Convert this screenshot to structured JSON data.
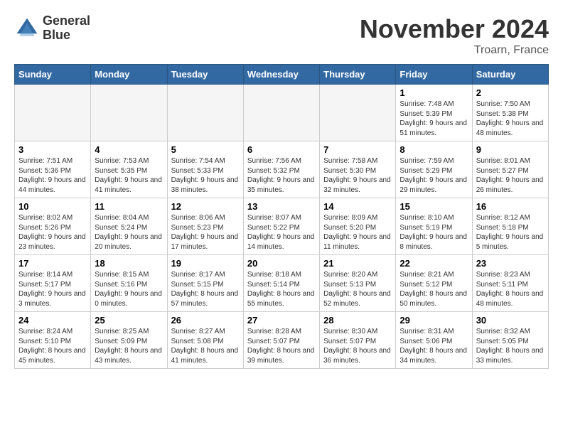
{
  "header": {
    "logo_line1": "General",
    "logo_line2": "Blue",
    "month": "November 2024",
    "location": "Troarn, France"
  },
  "weekdays": [
    "Sunday",
    "Monday",
    "Tuesday",
    "Wednesday",
    "Thursday",
    "Friday",
    "Saturday"
  ],
  "weeks": [
    [
      {
        "day": "",
        "empty": true
      },
      {
        "day": "",
        "empty": true
      },
      {
        "day": "",
        "empty": true
      },
      {
        "day": "",
        "empty": true
      },
      {
        "day": "",
        "empty": true
      },
      {
        "day": "1",
        "sunrise": "Sunrise: 7:48 AM",
        "sunset": "Sunset: 5:39 PM",
        "daylight": "Daylight: 9 hours and 51 minutes."
      },
      {
        "day": "2",
        "sunrise": "Sunrise: 7:50 AM",
        "sunset": "Sunset: 5:38 PM",
        "daylight": "Daylight: 9 hours and 48 minutes."
      }
    ],
    [
      {
        "day": "3",
        "sunrise": "Sunrise: 7:51 AM",
        "sunset": "Sunset: 5:36 PM",
        "daylight": "Daylight: 9 hours and 44 minutes."
      },
      {
        "day": "4",
        "sunrise": "Sunrise: 7:53 AM",
        "sunset": "Sunset: 5:35 PM",
        "daylight": "Daylight: 9 hours and 41 minutes."
      },
      {
        "day": "5",
        "sunrise": "Sunrise: 7:54 AM",
        "sunset": "Sunset: 5:33 PM",
        "daylight": "Daylight: 9 hours and 38 minutes."
      },
      {
        "day": "6",
        "sunrise": "Sunrise: 7:56 AM",
        "sunset": "Sunset: 5:32 PM",
        "daylight": "Daylight: 9 hours and 35 minutes."
      },
      {
        "day": "7",
        "sunrise": "Sunrise: 7:58 AM",
        "sunset": "Sunset: 5:30 PM",
        "daylight": "Daylight: 9 hours and 32 minutes."
      },
      {
        "day": "8",
        "sunrise": "Sunrise: 7:59 AM",
        "sunset": "Sunset: 5:29 PM",
        "daylight": "Daylight: 9 hours and 29 minutes."
      },
      {
        "day": "9",
        "sunrise": "Sunrise: 8:01 AM",
        "sunset": "Sunset: 5:27 PM",
        "daylight": "Daylight: 9 hours and 26 minutes."
      }
    ],
    [
      {
        "day": "10",
        "sunrise": "Sunrise: 8:02 AM",
        "sunset": "Sunset: 5:26 PM",
        "daylight": "Daylight: 9 hours and 23 minutes."
      },
      {
        "day": "11",
        "sunrise": "Sunrise: 8:04 AM",
        "sunset": "Sunset: 5:24 PM",
        "daylight": "Daylight: 9 hours and 20 minutes."
      },
      {
        "day": "12",
        "sunrise": "Sunrise: 8:06 AM",
        "sunset": "Sunset: 5:23 PM",
        "daylight": "Daylight: 9 hours and 17 minutes."
      },
      {
        "day": "13",
        "sunrise": "Sunrise: 8:07 AM",
        "sunset": "Sunset: 5:22 PM",
        "daylight": "Daylight: 9 hours and 14 minutes."
      },
      {
        "day": "14",
        "sunrise": "Sunrise: 8:09 AM",
        "sunset": "Sunset: 5:20 PM",
        "daylight": "Daylight: 9 hours and 11 minutes."
      },
      {
        "day": "15",
        "sunrise": "Sunrise: 8:10 AM",
        "sunset": "Sunset: 5:19 PM",
        "daylight": "Daylight: 9 hours and 8 minutes."
      },
      {
        "day": "16",
        "sunrise": "Sunrise: 8:12 AM",
        "sunset": "Sunset: 5:18 PM",
        "daylight": "Daylight: 9 hours and 5 minutes."
      }
    ],
    [
      {
        "day": "17",
        "sunrise": "Sunrise: 8:14 AM",
        "sunset": "Sunset: 5:17 PM",
        "daylight": "Daylight: 9 hours and 3 minutes."
      },
      {
        "day": "18",
        "sunrise": "Sunrise: 8:15 AM",
        "sunset": "Sunset: 5:16 PM",
        "daylight": "Daylight: 9 hours and 0 minutes."
      },
      {
        "day": "19",
        "sunrise": "Sunrise: 8:17 AM",
        "sunset": "Sunset: 5:15 PM",
        "daylight": "Daylight: 8 hours and 57 minutes."
      },
      {
        "day": "20",
        "sunrise": "Sunrise: 8:18 AM",
        "sunset": "Sunset: 5:14 PM",
        "daylight": "Daylight: 8 hours and 55 minutes."
      },
      {
        "day": "21",
        "sunrise": "Sunrise: 8:20 AM",
        "sunset": "Sunset: 5:13 PM",
        "daylight": "Daylight: 8 hours and 52 minutes."
      },
      {
        "day": "22",
        "sunrise": "Sunrise: 8:21 AM",
        "sunset": "Sunset: 5:12 PM",
        "daylight": "Daylight: 8 hours and 50 minutes."
      },
      {
        "day": "23",
        "sunrise": "Sunrise: 8:23 AM",
        "sunset": "Sunset: 5:11 PM",
        "daylight": "Daylight: 8 hours and 48 minutes."
      }
    ],
    [
      {
        "day": "24",
        "sunrise": "Sunrise: 8:24 AM",
        "sunset": "Sunset: 5:10 PM",
        "daylight": "Daylight: 8 hours and 45 minutes."
      },
      {
        "day": "25",
        "sunrise": "Sunrise: 8:25 AM",
        "sunset": "Sunset: 5:09 PM",
        "daylight": "Daylight: 8 hours and 43 minutes."
      },
      {
        "day": "26",
        "sunrise": "Sunrise: 8:27 AM",
        "sunset": "Sunset: 5:08 PM",
        "daylight": "Daylight: 8 hours and 41 minutes."
      },
      {
        "day": "27",
        "sunrise": "Sunrise: 8:28 AM",
        "sunset": "Sunset: 5:07 PM",
        "daylight": "Daylight: 8 hours and 39 minutes."
      },
      {
        "day": "28",
        "sunrise": "Sunrise: 8:30 AM",
        "sunset": "Sunset: 5:07 PM",
        "daylight": "Daylight: 8 hours and 36 minutes."
      },
      {
        "day": "29",
        "sunrise": "Sunrise: 8:31 AM",
        "sunset": "Sunset: 5:06 PM",
        "daylight": "Daylight: 8 hours and 34 minutes."
      },
      {
        "day": "30",
        "sunrise": "Sunrise: 8:32 AM",
        "sunset": "Sunset: 5:05 PM",
        "daylight": "Daylight: 8 hours and 33 minutes."
      }
    ]
  ]
}
